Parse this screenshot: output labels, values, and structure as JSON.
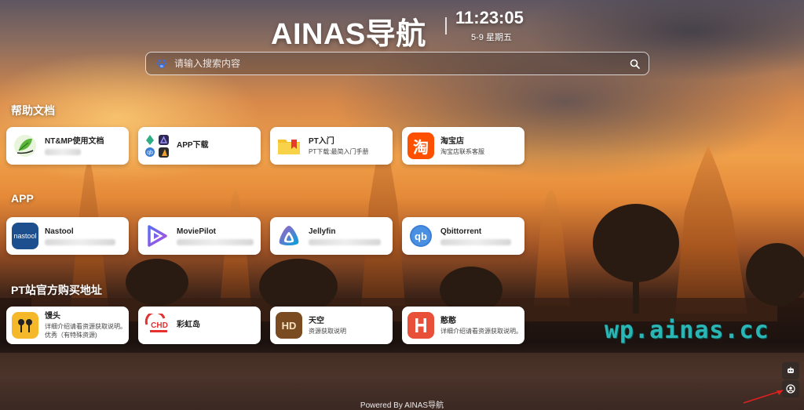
{
  "header": {
    "brand": "AINAS导航",
    "time": "11:23:05",
    "date": "5-9 星期五"
  },
  "search": {
    "placeholder": "请输入搜索内容",
    "engine_icon": "baidu-paw-icon",
    "button_icon": "search-icon"
  },
  "sections": [
    {
      "title": "帮助文档",
      "cards": [
        {
          "name": "NT&MP使用文档",
          "desc": "",
          "icon": "leaf-logo-icon"
        },
        {
          "name": "APP下载",
          "desc": "",
          "icon": "app-grid-icon"
        },
        {
          "name": "PT入门",
          "desc": "PT下载:最简入门手册",
          "icon": "folder-bookmark-icon"
        },
        {
          "name": "淘宝店",
          "desc": "淘宝店联系客服",
          "icon": "taobao-icon"
        }
      ]
    },
    {
      "title": "APP",
      "cards": [
        {
          "name": "Nastool",
          "desc": "",
          "icon": "nastool-icon"
        },
        {
          "name": "MoviePilot",
          "desc": "",
          "icon": "moviepilot-icon"
        },
        {
          "name": "Jellyfin",
          "desc": "",
          "icon": "jellyfin-icon"
        },
        {
          "name": "Qbittorrent",
          "desc": "",
          "icon": "qbittorrent-icon"
        }
      ]
    },
    {
      "title": "PT站官方购买地址",
      "cards": [
        {
          "name": "馒头",
          "desc": "详细介绍请看资源获取说明。优秀（有特殊资源)",
          "icon": "mteam-icon"
        },
        {
          "name": "彩虹岛",
          "desc": "",
          "icon": "chd-icon"
        },
        {
          "name": "天空",
          "desc": "资源获取说明",
          "icon": "hdsky-icon"
        },
        {
          "name": "憨憨",
          "desc": "详细介绍请看资源获取说明。",
          "icon": "hhan-icon"
        }
      ]
    }
  ],
  "watermark": "wp.ainas.cc",
  "footer": "Powered By AINAS导航",
  "side_buttons": [
    "robot-icon",
    "user-icon"
  ],
  "colors": {
    "watermark": "#2bb6b6",
    "taobao": "#ff5000",
    "nastool": "#1d4f8f",
    "moviepilot": "#7b4fe0",
    "jellyfin": "#7c5cd6",
    "qbittorrent": "#3a7fd4",
    "hdsky": "#7a4a20",
    "hhan": "#e8503a"
  }
}
